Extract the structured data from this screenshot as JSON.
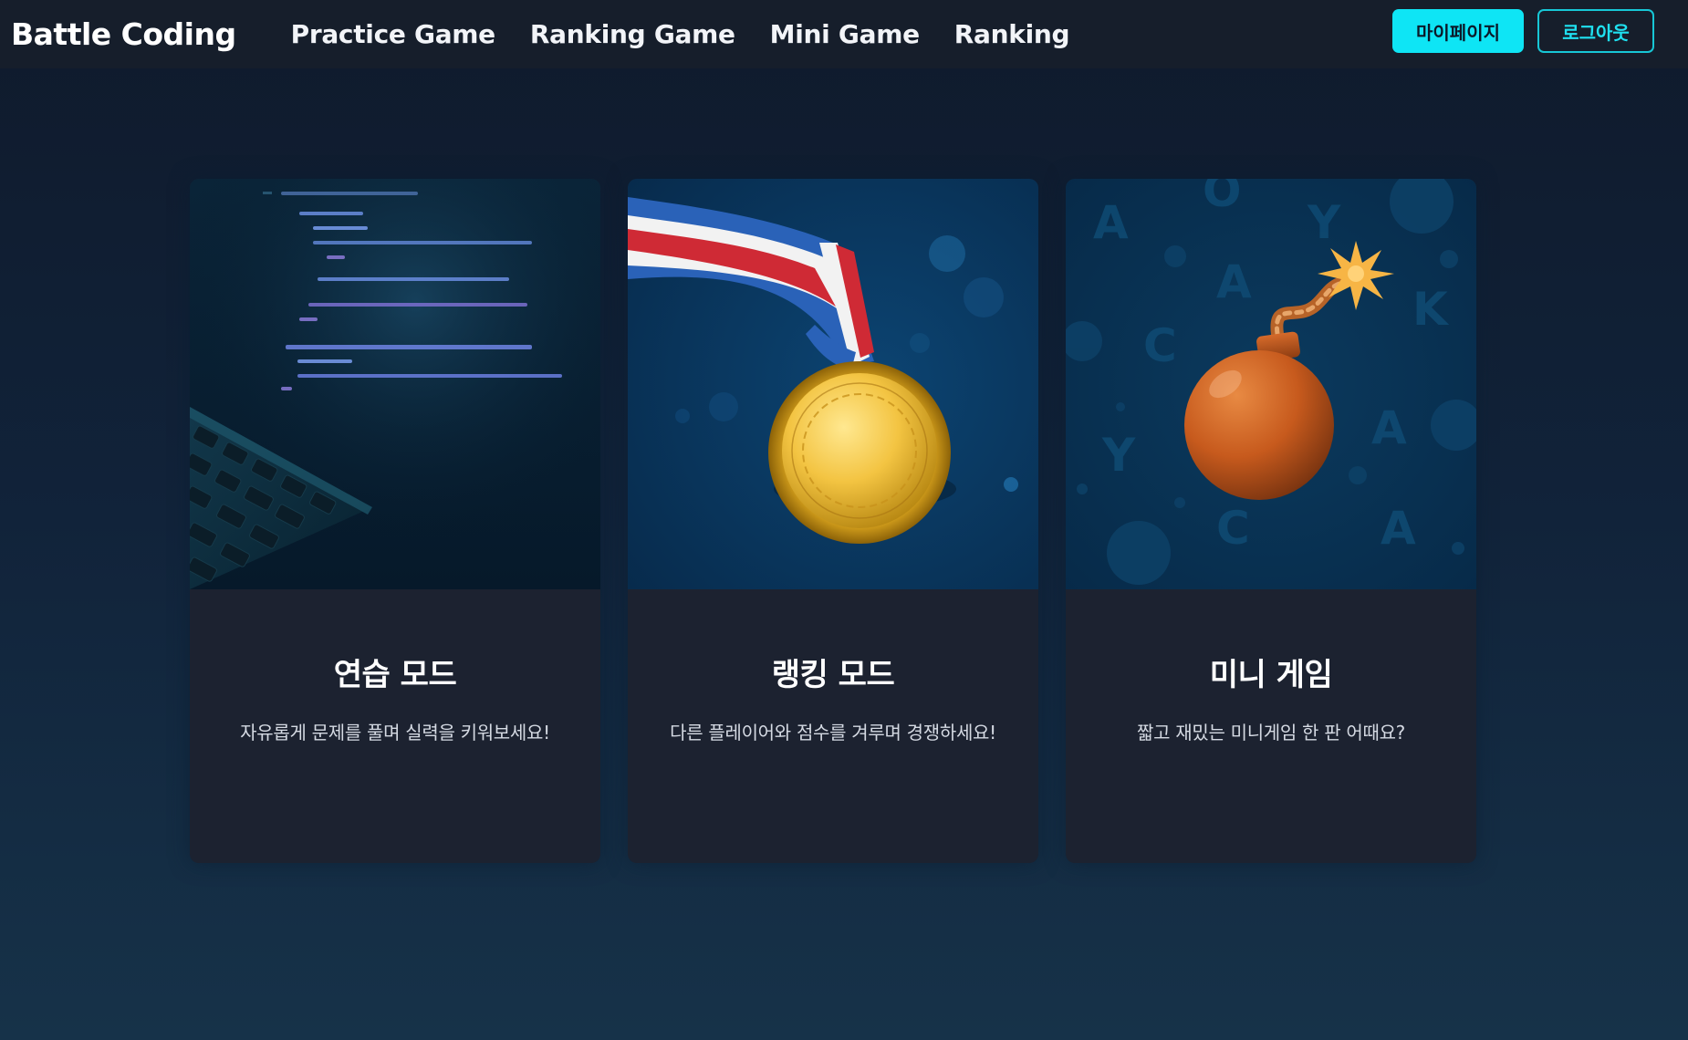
{
  "navbar": {
    "brand": "Battle Coding",
    "links": [
      "Practice Game",
      "Ranking Game",
      "Mini Game",
      "Ranking"
    ],
    "mypage_label": "마이페이지",
    "logout_label": "로그아웃"
  },
  "cards": [
    {
      "title": "연습 모드",
      "description": "자유롭게 문제를 풀며 실력을 키워보세요!",
      "image": "laptop-code-image"
    },
    {
      "title": "랭킹 모드",
      "description": "다른 플레이어와 점수를 겨루며 경쟁하세요!",
      "image": "gold-medal-image"
    },
    {
      "title": "미니 게임",
      "description": "짧고 재밌는 미니게임 한 판 어때요?",
      "image": "bomb-image"
    }
  ],
  "colors": {
    "accent": "#0ee5f5",
    "navbar_bg": "#161e2b",
    "card_bg": "#1c2230",
    "page_bg": "#11233a"
  }
}
